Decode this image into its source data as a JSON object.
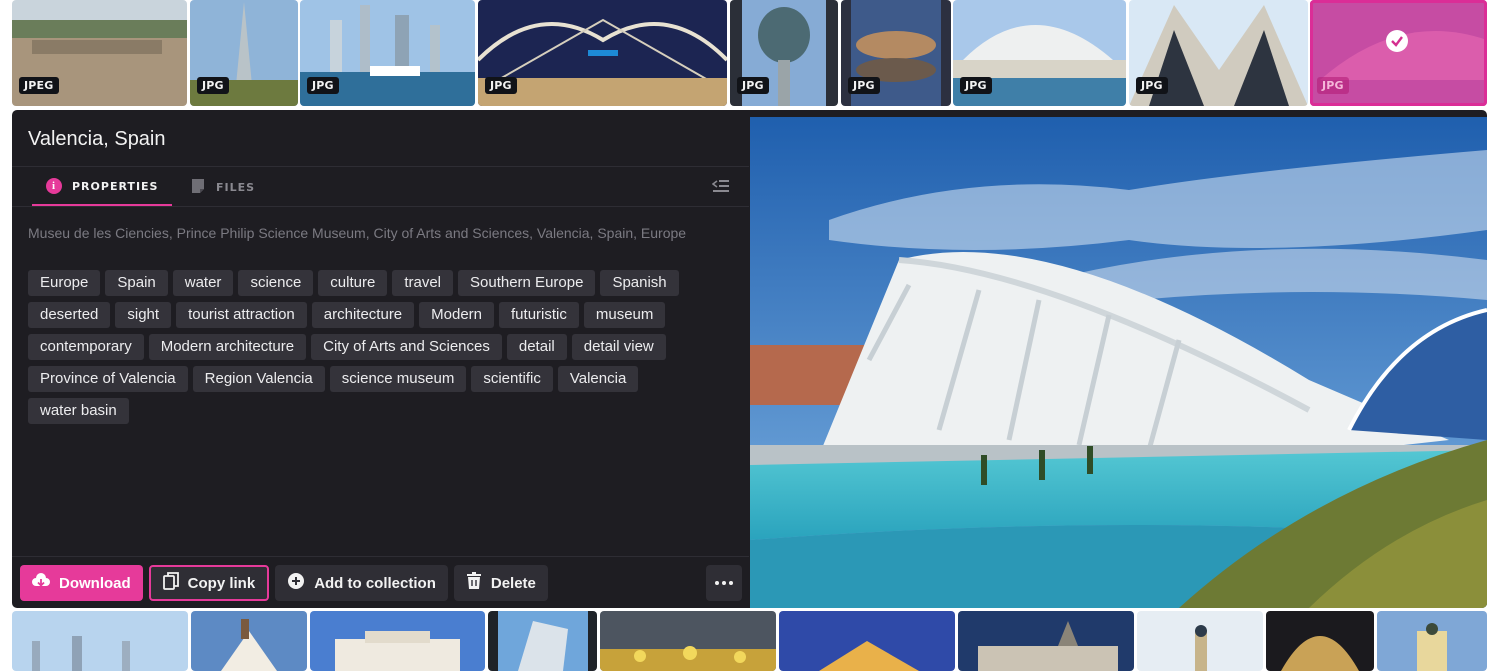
{
  "top_strip": [
    {
      "format": "JPEG"
    },
    {
      "format": "JPG"
    },
    {
      "format": "JPG"
    },
    {
      "format": "JPG"
    },
    {
      "format": "JPG"
    },
    {
      "format": "JPG"
    },
    {
      "format": "JPG"
    },
    {
      "format": "JPG"
    },
    {
      "format": "JPG",
      "selected": true
    }
  ],
  "detail": {
    "title": "Valencia, Spain",
    "tabs": [
      {
        "label": "PROPERTIES",
        "active": true,
        "icon": "info-icon"
      },
      {
        "label": "FILES",
        "active": false,
        "icon": "file-icon"
      }
    ],
    "description": "Museu de les Ciencies, Prince Philip Science Museum, City of Arts and Sciences, Valencia, Spain, Europe",
    "tags": [
      "Europe",
      "Spain",
      "water",
      "science",
      "culture",
      "travel",
      "Southern Europe",
      "Spanish",
      "deserted",
      "sight",
      "tourist attraction",
      "architecture",
      "Modern",
      "futuristic",
      "museum",
      "contemporary",
      "Modern architecture",
      "City of Arts and Sciences",
      "detail",
      "detail view",
      "Province of Valencia",
      "Region Valencia",
      "science museum",
      "scientific",
      "Valencia",
      "water basin"
    ],
    "actions": {
      "download": "Download",
      "copy_link": "Copy link",
      "add_to_collection": "Add to collection",
      "delete": "Delete"
    }
  },
  "colors": {
    "accent": "#e63a9a",
    "panel_bg": "#1e1d22",
    "tag_bg": "#34333a"
  }
}
